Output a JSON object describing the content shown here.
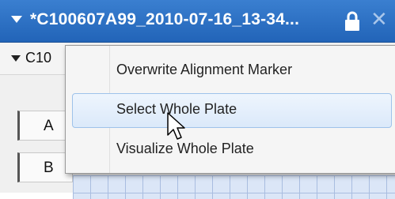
{
  "window": {
    "title": "*C100607A99_2010-07-16_13-34...",
    "close_glyph": "✕"
  },
  "subbar": {
    "label": "C10"
  },
  "plate": {
    "rows": [
      {
        "label": "A"
      },
      {
        "label": "B"
      }
    ]
  },
  "context_menu": {
    "items": [
      {
        "label": "Overwrite Alignment Marker"
      },
      {
        "label": "Select Whole Plate",
        "highlighted": true
      },
      {
        "label": "Visualize Whole Plate"
      }
    ]
  },
  "colors": {
    "titlebar": "#2b6fc4",
    "menu_highlight": "#dbe9fa",
    "grid": "#dbe6f7"
  },
  "icons": {
    "title_toggle": "triangle-down-icon",
    "lock": "lock-icon",
    "close": "close-icon",
    "cursor": "arrow-cursor-icon"
  }
}
